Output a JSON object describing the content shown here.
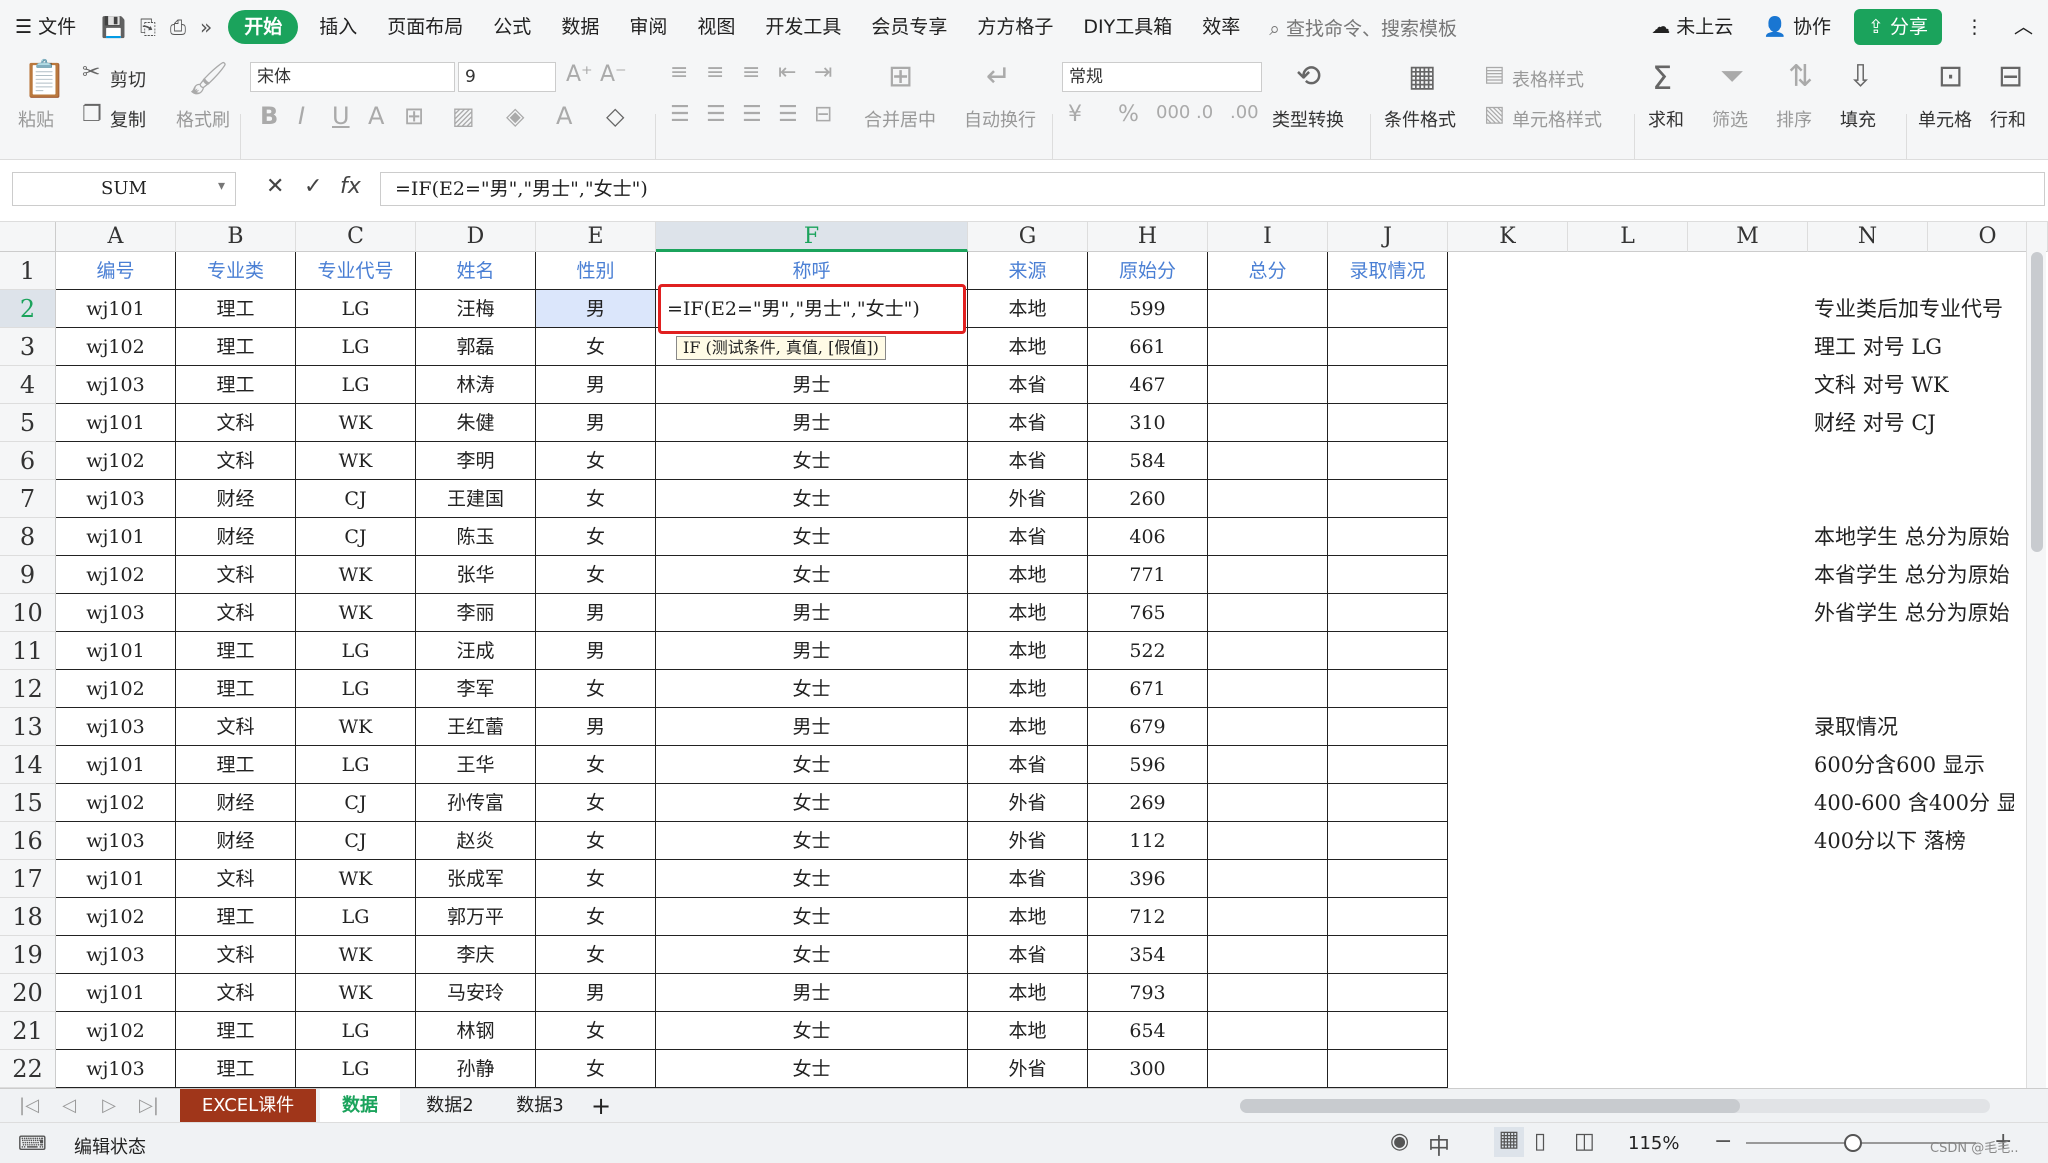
{
  "menu": {
    "file": "文件",
    "tabs": [
      "开始",
      "插入",
      "页面布局",
      "公式",
      "数据",
      "审阅",
      "视图",
      "开发工具",
      "会员专享",
      "方方格子",
      "DIY工具箱",
      "效率"
    ],
    "search": "查找命令、搜索模板",
    "cloud": "未上云",
    "collab": "协作",
    "share": "分享"
  },
  "ribbon": {
    "paste": "粘贴",
    "cut": "剪切",
    "copy": "复制",
    "format_painter": "格式刷",
    "font": "宋体",
    "font_size": "9",
    "merge": "合并居中",
    "wrap": "自动换行",
    "number_format": "常规",
    "type_convert": "类型转换",
    "cond_format": "条件格式",
    "table_style": "表格样式",
    "cell_style": "单元格样式",
    "sum": "求和",
    "filter": "筛选",
    "sort": "排序",
    "fill": "填充",
    "cell": "单元格",
    "rowcol": "行和"
  },
  "formula_bar": {
    "name_box": "SUM",
    "fx": "fx",
    "formula": "=IF(E2=\"男\",\"男士\",\"女士\")"
  },
  "columns": [
    "A",
    "B",
    "C",
    "D",
    "E",
    "F",
    "G",
    "H",
    "I",
    "J",
    "K",
    "L",
    "M",
    "N",
    "O"
  ],
  "headers": [
    "编号",
    "专业类",
    "专业代号",
    "姓名",
    "性别",
    "称呼",
    "来源",
    "原始分",
    "总分",
    "录取情况"
  ],
  "rows": [
    [
      "wj101",
      "理工",
      "LG",
      "汪梅",
      "男",
      "",
      "本地",
      "599"
    ],
    [
      "wj102",
      "理工",
      "LG",
      "郭磊",
      "女",
      "",
      "本地",
      "661"
    ],
    [
      "wj103",
      "理工",
      "LG",
      "林涛",
      "男",
      "男士",
      "本省",
      "467"
    ],
    [
      "wj101",
      "文科",
      "WK",
      "朱健",
      "男",
      "男士",
      "本省",
      "310"
    ],
    [
      "wj102",
      "文科",
      "WK",
      "李明",
      "女",
      "女士",
      "本省",
      "584"
    ],
    [
      "wj103",
      "财经",
      "CJ",
      "王建国",
      "女",
      "女士",
      "外省",
      "260"
    ],
    [
      "wj101",
      "财经",
      "CJ",
      "陈玉",
      "女",
      "女士",
      "本省",
      "406"
    ],
    [
      "wj102",
      "文科",
      "WK",
      "张华",
      "女",
      "女士",
      "本地",
      "771"
    ],
    [
      "wj103",
      "文科",
      "WK",
      "李丽",
      "男",
      "男士",
      "本地",
      "765"
    ],
    [
      "wj101",
      "理工",
      "LG",
      "汪成",
      "男",
      "男士",
      "本地",
      "522"
    ],
    [
      "wj102",
      "理工",
      "LG",
      "李军",
      "女",
      "女士",
      "本地",
      "671"
    ],
    [
      "wj103",
      "文科",
      "WK",
      "王红蕾",
      "男",
      "男士",
      "本地",
      "679"
    ],
    [
      "wj101",
      "理工",
      "LG",
      "王华",
      "女",
      "女士",
      "本省",
      "596"
    ],
    [
      "wj102",
      "财经",
      "CJ",
      "孙传富",
      "女",
      "女士",
      "外省",
      "269"
    ],
    [
      "wj103",
      "财经",
      "CJ",
      "赵炎",
      "女",
      "女士",
      "外省",
      "112"
    ],
    [
      "wj101",
      "文科",
      "WK",
      "张成军",
      "女",
      "女士",
      "本省",
      "396"
    ],
    [
      "wj102",
      "理工",
      "LG",
      "郭万平",
      "女",
      "女士",
      "本地",
      "712"
    ],
    [
      "wj103",
      "文科",
      "WK",
      "李庆",
      "女",
      "女士",
      "本省",
      "354"
    ],
    [
      "wj101",
      "文科",
      "WK",
      "马安玲",
      "男",
      "男士",
      "本地",
      "793"
    ],
    [
      "wj102",
      "理工",
      "LG",
      "林钢",
      "女",
      "女士",
      "本地",
      "654"
    ],
    [
      "wj103",
      "理工",
      "LG",
      "孙静",
      "女",
      "女士",
      "外省",
      "300"
    ]
  ],
  "edit": {
    "formula": "=IF(E2=\"男\",\"男士\",\"女士\")",
    "hint": "IF (测试条件, 真值, [假值])"
  },
  "side_notes": [
    "专业类后加专业代号",
    "理工 对号  LG",
    "文科  对号  WK",
    "财经  对号  CJ",
    "本地学生  总分为原始",
    "本省学生  总分为原始",
    "外省学生  总分为原始",
    "录取情况",
    "600分含600      显示",
    "400-600  含400分      显",
    "400分以下             落榜"
  ],
  "sheets": [
    "EXCEL课件",
    "数据",
    "数据2",
    "数据3"
  ],
  "status": {
    "mode": "编辑状态",
    "zoom": "115%",
    "watermark": "CSDN @毛毛.."
  },
  "colors": {
    "accent": "#1ba35c",
    "header_text": "#4a7fd4",
    "highlight": "#e02020"
  }
}
